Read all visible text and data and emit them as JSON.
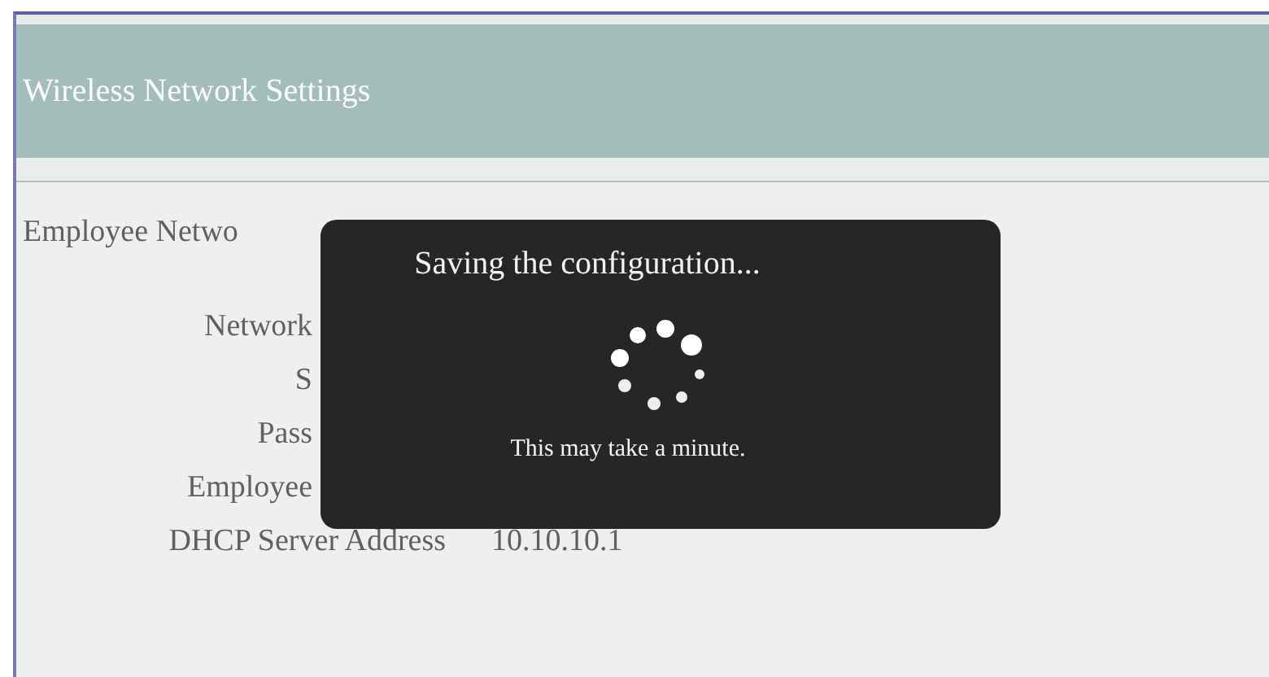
{
  "header": {
    "title": "Wireless Network Settings"
  },
  "section": {
    "title": "Employee Netwo"
  },
  "fields": [
    {
      "label": "Network"
    },
    {
      "label": "S"
    },
    {
      "label": "Pass"
    },
    {
      "label": "Employee"
    },
    {
      "label": "DHCP Server Address",
      "value": "10.10.10.1"
    }
  ],
  "dialog": {
    "title": "Saving the configuration...",
    "message": "This may take a minute."
  }
}
